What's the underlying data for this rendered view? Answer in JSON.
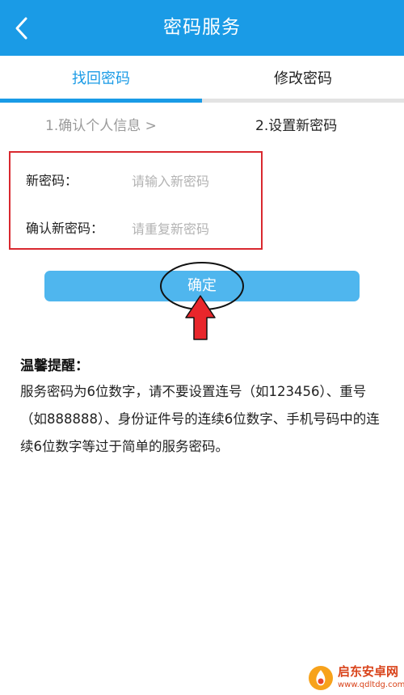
{
  "header": {
    "title": "密码服务",
    "back_icon": "chevron-left-icon",
    "background": "#1a9be6"
  },
  "tabs": [
    {
      "label": "找回密码",
      "active": true
    },
    {
      "label": "修改密码",
      "active": false
    }
  ],
  "steps": {
    "step1": "1.确认个人信息 >",
    "step2": "2.设置新密码"
  },
  "form": {
    "new_password_label": "新密码：",
    "new_password_placeholder": "请输入新密码",
    "new_password_value": "",
    "confirm_password_label": "确认新密码：",
    "confirm_password_placeholder": "请重复新密码",
    "confirm_password_value": ""
  },
  "confirm_button": {
    "label": "确定",
    "color": "#4fb6ee"
  },
  "tips": {
    "title": "温馨提醒：",
    "body": "服务密码为6位数字，请不要设置连号（如123456）、重号（如888888）、身份证件号的连续6位数字、手机号码中的连续6位数字等过于简单的服务密码。"
  },
  "annotations": {
    "highlight_box_color": "#d9282f",
    "arrow_color": "#e8262b"
  },
  "watermark": {
    "main": "启东安卓网",
    "sub": "www.qdltdg.com"
  }
}
